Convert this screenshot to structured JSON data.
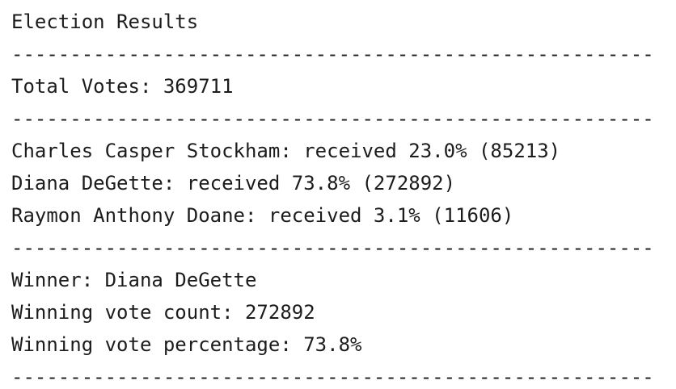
{
  "report": {
    "title": "Election Results",
    "separator": "-------------------------------------------------------",
    "total_votes": "Total Votes: 369711",
    "candidates": [
      "Charles Casper Stockham: received 23.0% (85213)",
      "Diana DeGette: received 73.8% (272892)",
      "Raymon Anthony Doane: received 3.1% (11606)"
    ],
    "winner": "Winner: Diana DeGette",
    "winning_vote_count": "Winning vote count: 272892",
    "winning_vote_percentage": "Winning vote percentage: 73.8%"
  }
}
